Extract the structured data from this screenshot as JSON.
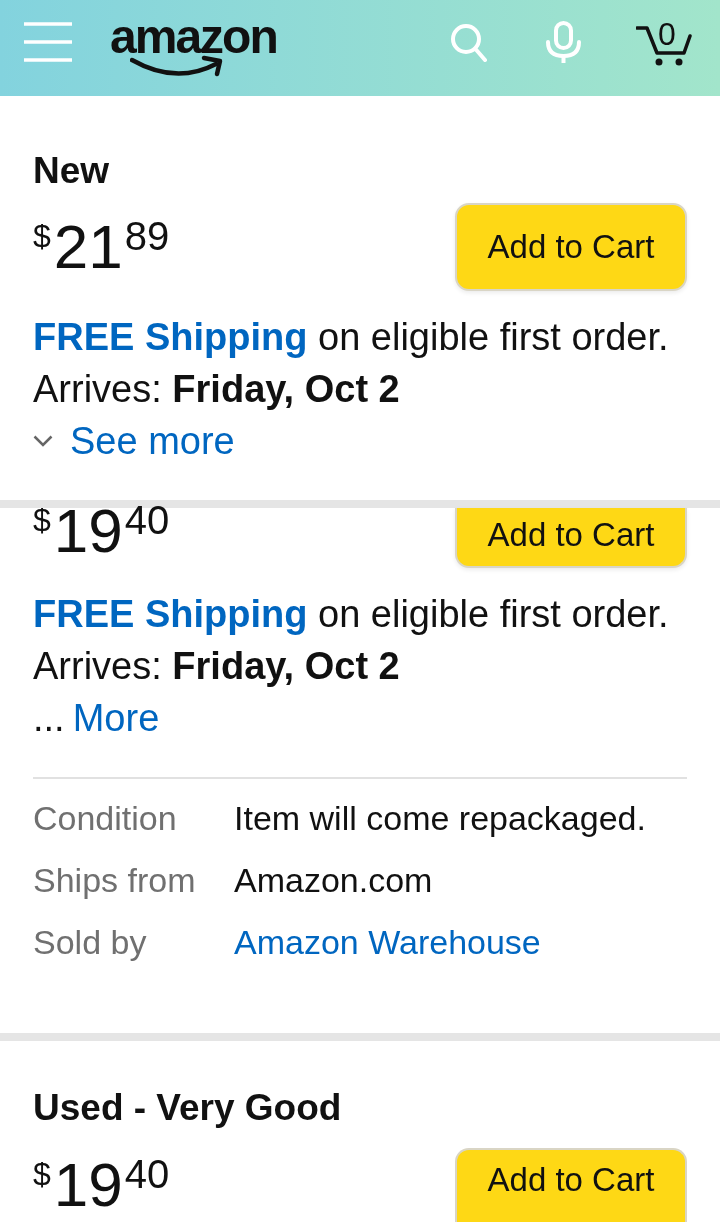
{
  "header": {
    "logo": "amazon",
    "cart_count": "0"
  },
  "pinned_offer": {
    "condition": "New",
    "price": {
      "symbol": "$",
      "whole": "21",
      "fraction": "89"
    },
    "button": "Add to Cart",
    "shipping": {
      "link": "FREE Shipping",
      "text": " on eligible first order."
    },
    "arrival": "Arrives: **Friday, Oct 2**",
    "expander": {
      "kind": "see_more",
      "label": "See more"
    }
  },
  "offers": [
    {
      "price": {
        "symbol": "$",
        "whole": "19",
        "fraction": "40"
      },
      "button": "Add to Cart",
      "shipping": {
        "link": "FREE Shipping",
        "text": " on eligible first order."
      },
      "arrival": "Arrives: **Friday, Oct 2**",
      "expander": {
        "kind": "more",
        "prefix": "...",
        "label": "More"
      },
      "details": [
        {
          "kind": "text",
          "label": "Condition",
          "value": "Item will come repackaged."
        },
        {
          "kind": "text",
          "label": "Ships from",
          "value": "Amazon.com"
        },
        {
          "kind": "link",
          "label": "Sold by",
          "value": "Amazon Warehouse"
        }
      ]
    },
    {
      "condition": "Used - Very Good",
      "price": {
        "symbol": "$",
        "whole": "19",
        "fraction": "40"
      },
      "button": "Add to Cart"
    }
  ]
}
